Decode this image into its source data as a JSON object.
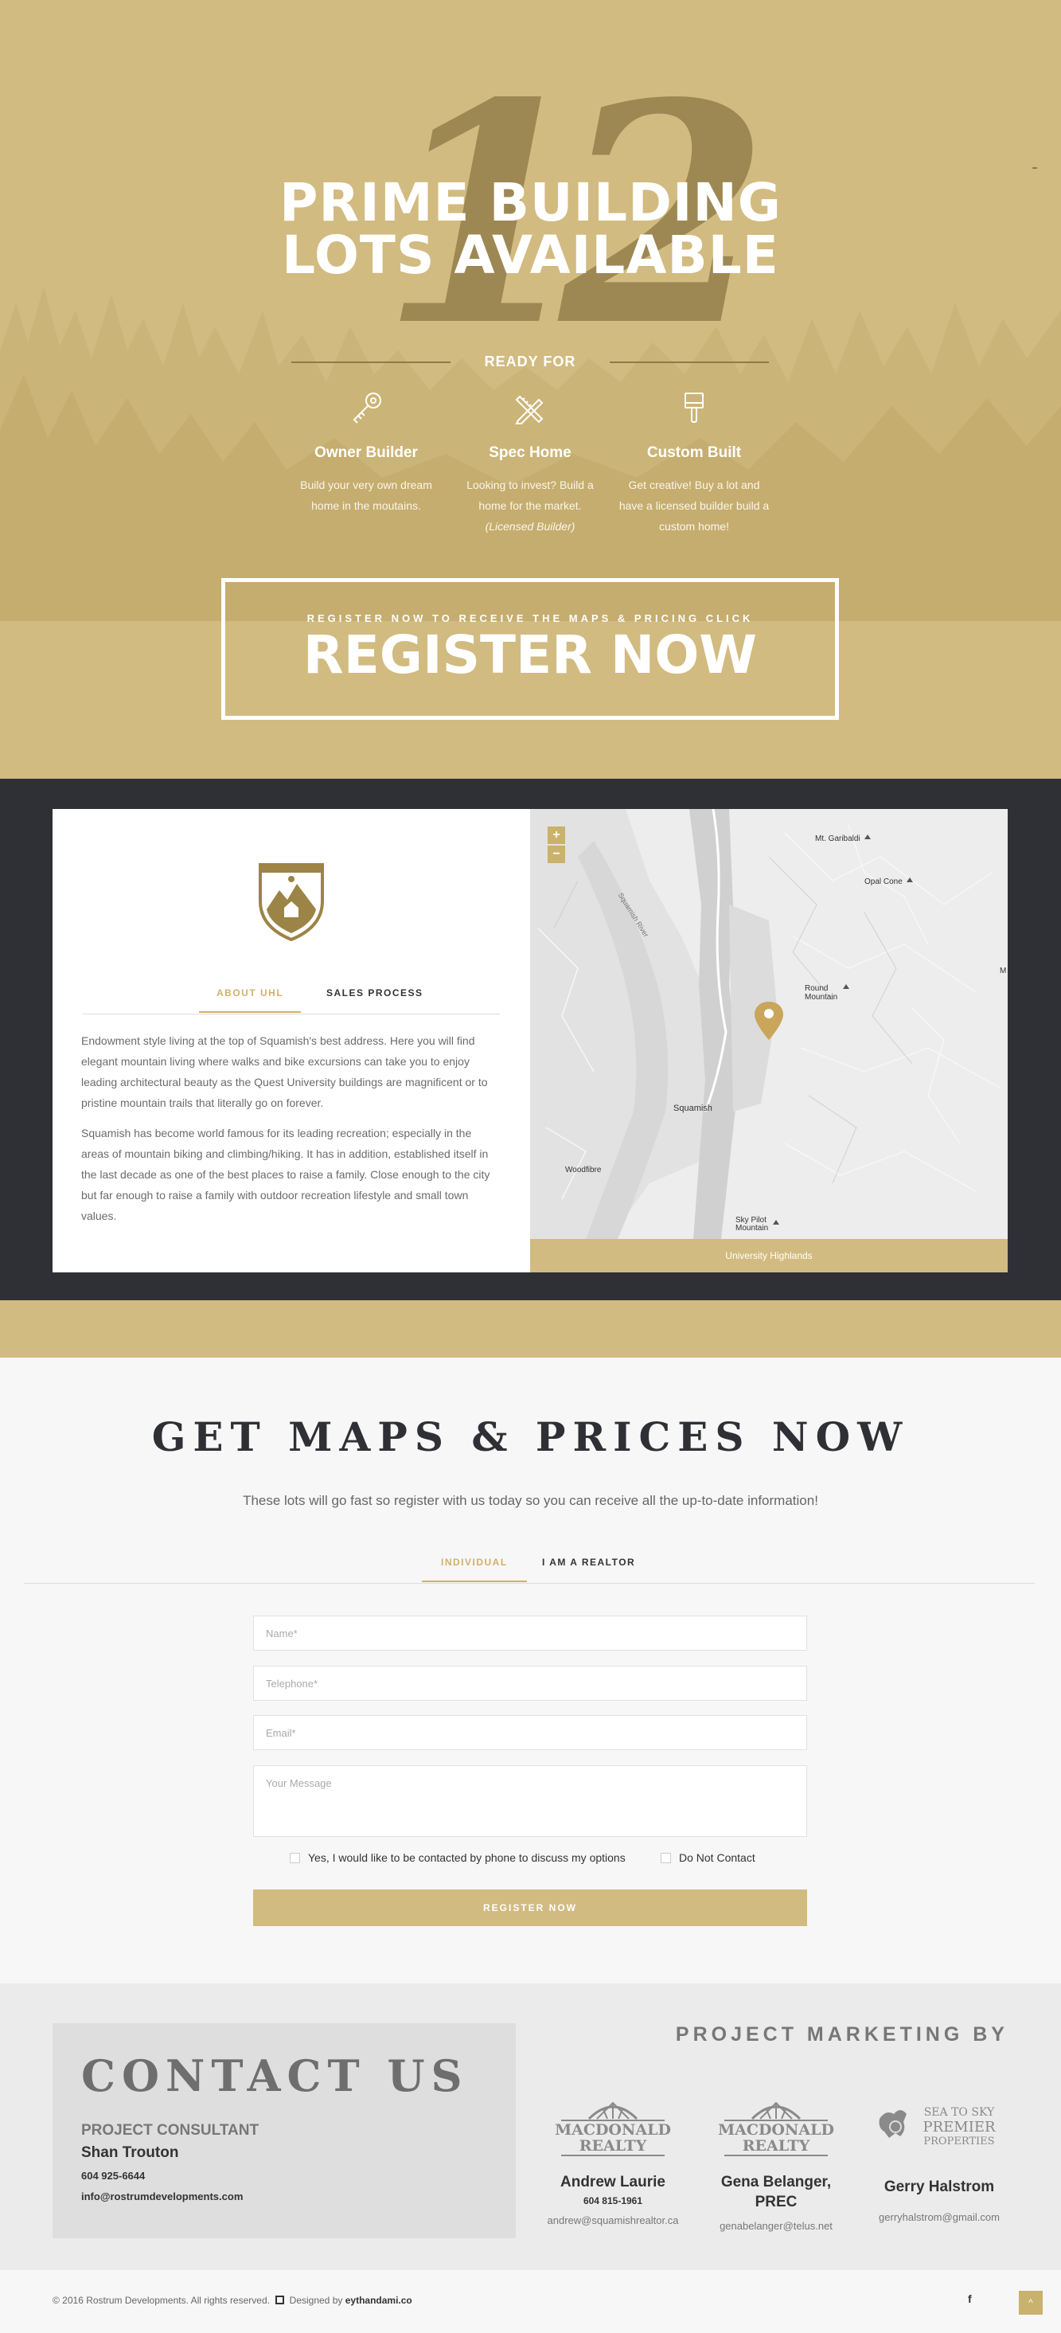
{
  "hero": {
    "number": "12",
    "title_line1": "PRIME BUILDING",
    "title_line2": "LOTS AVAILABLE",
    "ready_for": "READY FOR",
    "features": [
      {
        "icon": "key-icon",
        "title": "Owner Builder",
        "text": "Build your very own dream home in the moutains.",
        "note": ""
      },
      {
        "icon": "pencil-ruler-icon",
        "title": "Spec Home",
        "text": "Looking to invest? Build a home for the market.",
        "note": "(Licensed Builder)"
      },
      {
        "icon": "paint-brush-icon",
        "title": "Custom Built",
        "text": "Get creative! Buy a lot and have a licensed builder build a custom home!",
        "note": ""
      }
    ],
    "register_small": "REGISTER NOW TO RECEIVE THE MAPS & PRICING CLICK",
    "register_big": "REGISTER NOW"
  },
  "about": {
    "tabs": [
      "ABOUT UHL",
      "SALES PROCESS"
    ],
    "paragraph1": "Endowment style living at the top of Squamish's best address. Here you will find elegant mountain living where walks and bike excursions can take you to enjoy leading architectural beauty as the Quest University buildings are magnificent or to pristine mountain trails that literally go on forever.",
    "paragraph2": "Squamish has become world famous for its leading recreation; especially in the areas of mountain biking and climbing/hiking. It has in addition, established itself in the last decade as one of the best places to raise a family. Close enough to the city but far enough to raise a family with outdoor recreation lifestyle and small town values."
  },
  "map": {
    "zoom_in": "+",
    "zoom_out": "−",
    "labels": {
      "garibaldi": "Mt. Garibaldi",
      "opal": "Opal Cone",
      "round": "Round Mountain",
      "squamish": "Squamish",
      "woodfibre": "Woodfibre",
      "skypilot": "Sky Pilot Mountain",
      "river": "Squamish River",
      "edge": "M"
    },
    "caption": "University Highlands"
  },
  "form": {
    "heading": "GET MAPS & PRICES NOW",
    "subtitle": "These lots will go fast so register with us today so you can receive all the up-to-date information!",
    "tabs": [
      "INDIVIDUAL",
      "I AM A REALTOR"
    ],
    "placeholders": {
      "name": "Name*",
      "telephone": "Telephone*",
      "email": "Email*",
      "message": "Your Message"
    },
    "check_phone": "Yes, I would like to be contacted by phone to discuss my options",
    "check_no_contact": "Do Not Contact",
    "submit": "REGISTER NOW"
  },
  "contact": {
    "heading": "CONTACT US",
    "role": "PROJECT CONSULTANT",
    "name": "Shan Trouton",
    "phone": "604 925-6644",
    "email": "info@rostrumdevelopments.com"
  },
  "marketing": {
    "heading": "PROJECT MARKETING BY",
    "agents": [
      {
        "logo_line1": "MACDONALD",
        "logo_line2": "REALTY",
        "name": "Andrew Laurie",
        "phone": "604 815-1961",
        "email": "andrew@squamishrealtor.ca"
      },
      {
        "logo_line1": "MACDONALD",
        "logo_line2": "REALTY",
        "name": "Gena Belanger, PREC",
        "phone": "",
        "email": "genabelanger@telus.net"
      },
      {
        "logo_line1": "SEA TO SKY",
        "logo_line2": "PREMIER",
        "logo_line3": "PROPERTIES",
        "name": "Gerry Halstrom",
        "phone": "",
        "email": "gerryhalstrom@gmail.com"
      }
    ]
  },
  "footer": {
    "copyright": "© 2016 Rostrum Developments. All rights reserved.",
    "designed_by": "Designed by",
    "designer": "eythandami.co",
    "facebook": "f",
    "back_to_top": "^"
  }
}
